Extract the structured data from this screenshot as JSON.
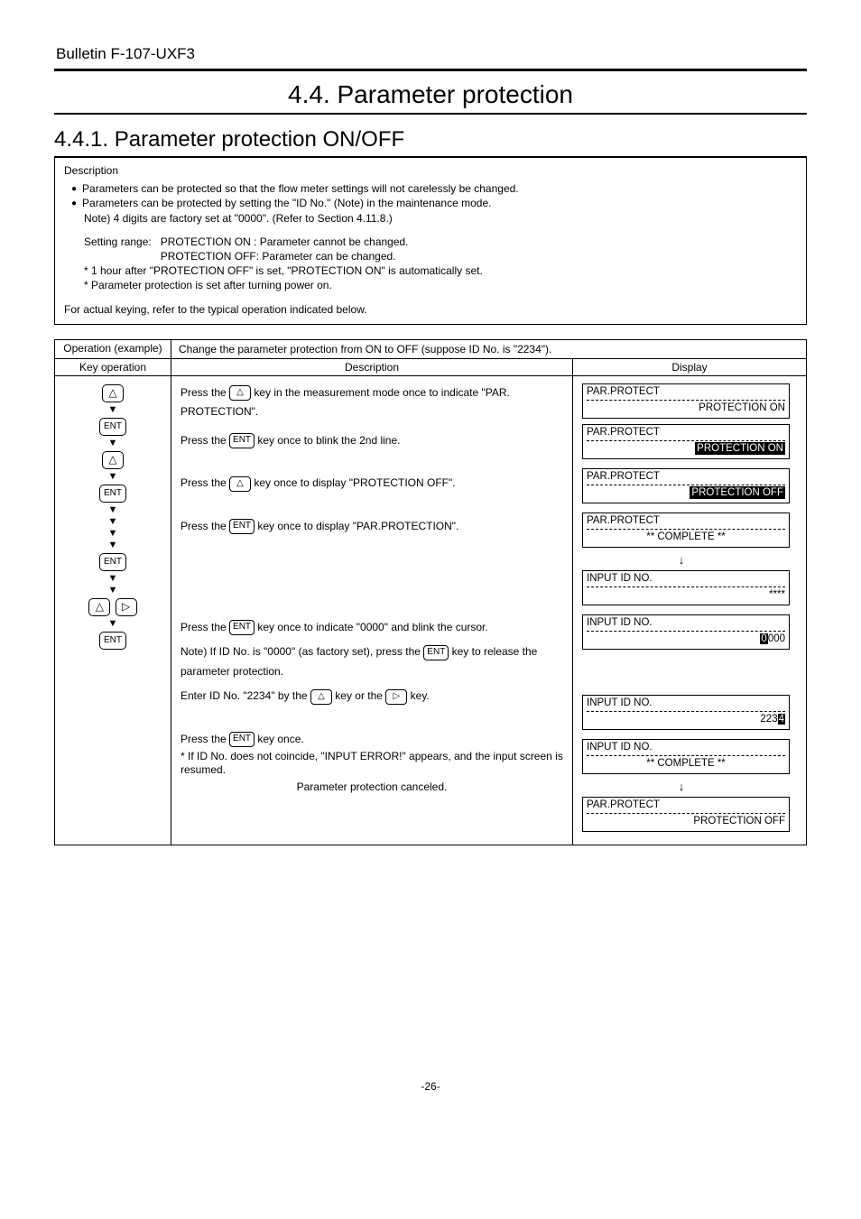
{
  "header": {
    "bulletin": "Bulletin F-107-UXF3"
  },
  "section": {
    "title": "4.4. Parameter protection",
    "subtitle": "4.4.1. Parameter protection ON/OFF"
  },
  "description": {
    "label": "Description",
    "bullets": [
      "Parameters can be protected so that the flow meter settings will not carelessly be changed.",
      "Parameters can be protected by setting the \"ID No.\" (Note) in the maintenance mode."
    ],
    "note_line": "Note) 4 digits are factory set at \"0000\". (Refer to Section 4.11.8.)",
    "setting_label": "Setting range:",
    "setting_on": "PROTECTION ON  : Parameter cannot be changed.",
    "setting_off": "PROTECTION OFF: Parameter can be changed.",
    "star1": "* 1 hour after \"PROTECTION OFF\" is set, \"PROTECTION ON\" is automatically set.",
    "star2": "* Parameter protection is set after turning power on.",
    "final": "For actual keying, refer to the typical operation indicated below."
  },
  "table": {
    "op_header": "Operation (example)",
    "example_text": "Change the parameter protection from ON to OFF (suppose ID No. is \"2234\").",
    "key_op_header": "Key operation",
    "desc_header": "Description",
    "disp_header": "Display"
  },
  "steps": {
    "s1_desc_a": "Press the ",
    "s1_desc_b": " key in the measurement mode once to indicate \"PAR. PROTECTION\".",
    "s1_desc_c": "Press the ",
    "s1_desc_d": " key once to blink the 2nd line.",
    "s2_desc_a": "Press the ",
    "s2_desc_b": " key once to display \"PROTECTION OFF\".",
    "s3_desc_a": "Press the ",
    "s3_desc_b": " key once to display \"PAR.PROTECTION\".",
    "s4_desc_a": "Press the ",
    "s4_desc_b": " key once to indicate \"0000\" and blink the cursor.",
    "s4_note_a": "Note)  If ID No. is \"0000\" (as factory set), press the ",
    "s4_note_b": " key to release the parameter protection.",
    "s5_desc_a": "Enter ID No. \"2234\" by the ",
    "s5_desc_mid": " key or the ",
    "s5_desc_b": " key.",
    "s6_desc_a": "Press the ",
    "s6_desc_b": " key once.",
    "s6_err": "* If ID No. does not coincide, \"INPUT ERROR!\" appears, and the input screen is resumed.",
    "s6_cancel": "Parameter protection canceled."
  },
  "lcd": {
    "par_protect": "PAR.PROTECT",
    "prot_on": "PROTECTION ON",
    "prot_off": "PROTECTION OFF",
    "complete": "** COMPLETE **",
    "input_id": "INPUT ID NO.",
    "stars": "****",
    "zero3": "000",
    "n223": "223",
    "n4": "4",
    "n0": "0"
  },
  "keys": {
    "up": "△",
    "right": "▷",
    "ent": "ENT",
    "down": "▼",
    "darrow": "↓"
  },
  "footer": {
    "page": "-26-"
  }
}
